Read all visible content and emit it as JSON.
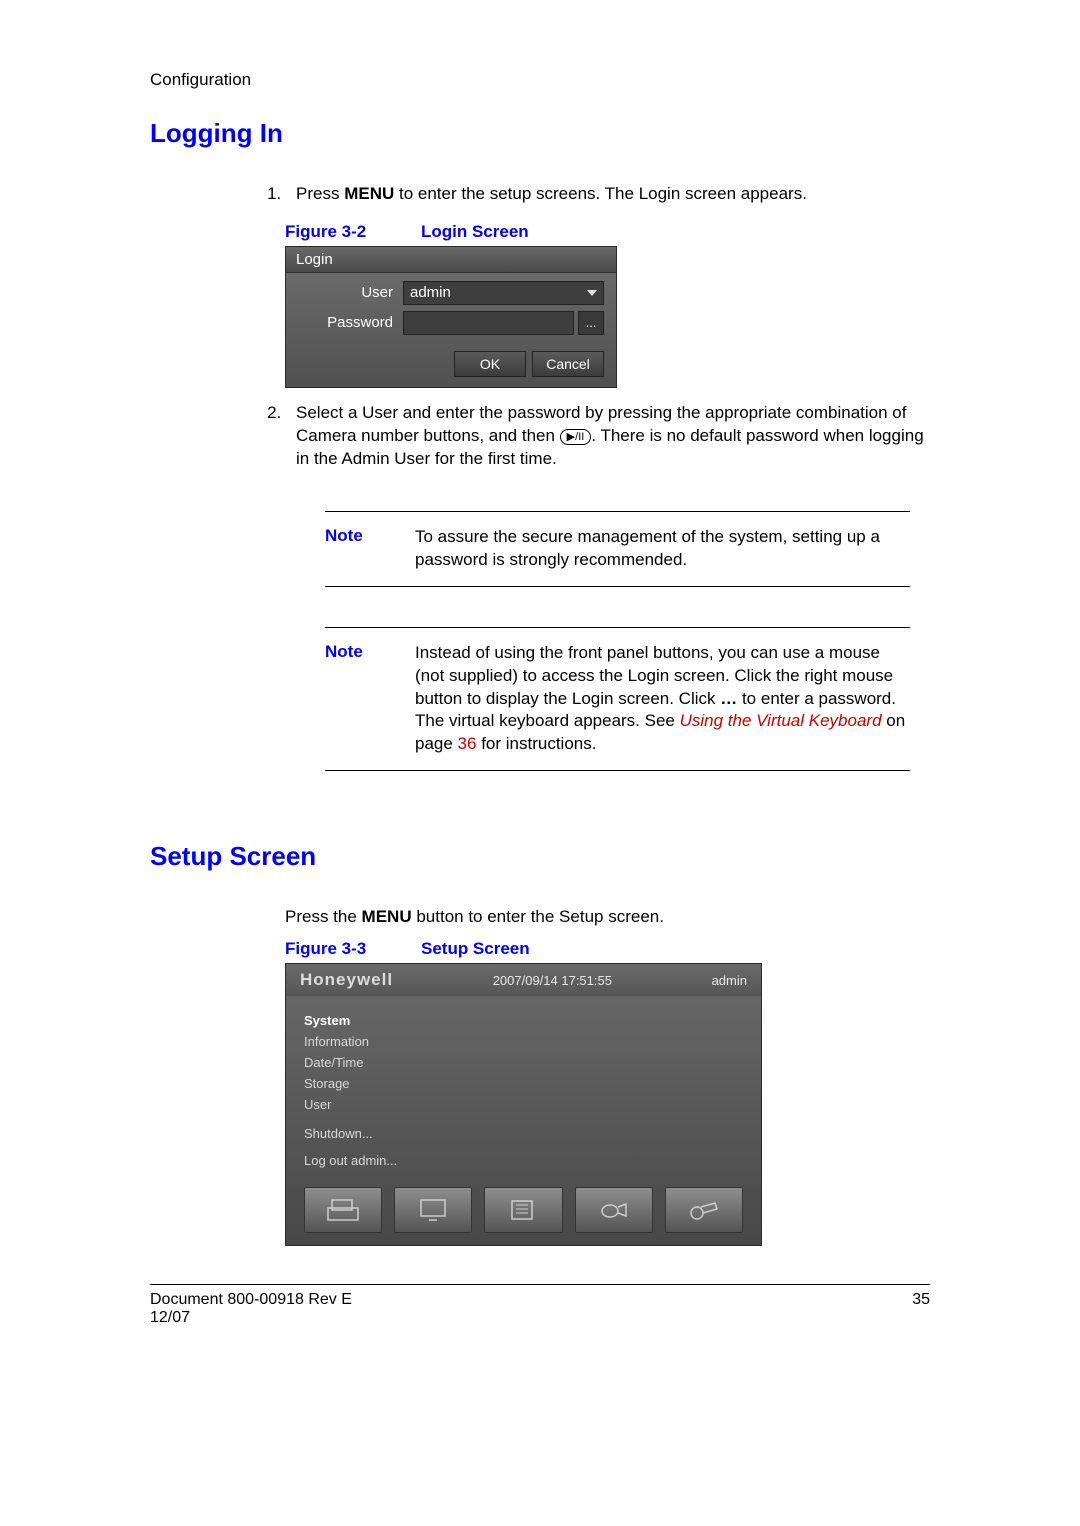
{
  "header": {
    "section_label": "Configuration"
  },
  "sec1": {
    "heading": "Logging In",
    "steps": {
      "s1_a": "Press ",
      "s1_menu": "MENU",
      "s1_b": " to enter the setup screens. The Login screen appears.",
      "s2_a": "Select a User and enter the password by pressing the appropriate combination of Camera number buttons, and then ",
      "s2_icon": "▶/II",
      "s2_b": ". There is no default password when logging in the Admin User for the first time."
    },
    "figure": {
      "label": "Figure 3-2",
      "title": "Login Screen"
    },
    "login": {
      "title": "Login",
      "user_label": "User",
      "user_value": "admin",
      "pwd_label": "Password",
      "dots": "...",
      "ok": "OK",
      "cancel": "Cancel"
    },
    "note1": {
      "label": "Note",
      "text": "To assure the secure management of the system, setting up a password is strongly recommended."
    },
    "note2": {
      "label": "Note",
      "text_a": "Instead of using the front panel buttons, you can use a mouse (not supplied) to access the Login screen. Click the right mouse button to display the Login screen. Click ",
      "dots": "…",
      "text_b": " to enter a password. The virtual keyboard appears. See ",
      "ref": "Using the Virtual Keyboard",
      "text_c": " on page ",
      "page": "36",
      "text_d": " for instructions."
    }
  },
  "sec2": {
    "heading": "Setup Screen",
    "intro_a": "Press the ",
    "intro_menu": "MENU",
    "intro_b": " button to enter the Setup screen.",
    "figure": {
      "label": "Figure 3-3",
      "title": "Setup Screen"
    },
    "setup": {
      "brand": "Honeywell",
      "timestamp": "2007/09/14  17:51:55",
      "user": "admin",
      "menu": [
        "System",
        "Information",
        "Date/Time",
        "Storage",
        "User",
        "Shutdown...",
        "Log out admin..."
      ]
    }
  },
  "footer": {
    "doc": "Document 800-00918 Rev E",
    "date": "12/07",
    "page": "35"
  }
}
